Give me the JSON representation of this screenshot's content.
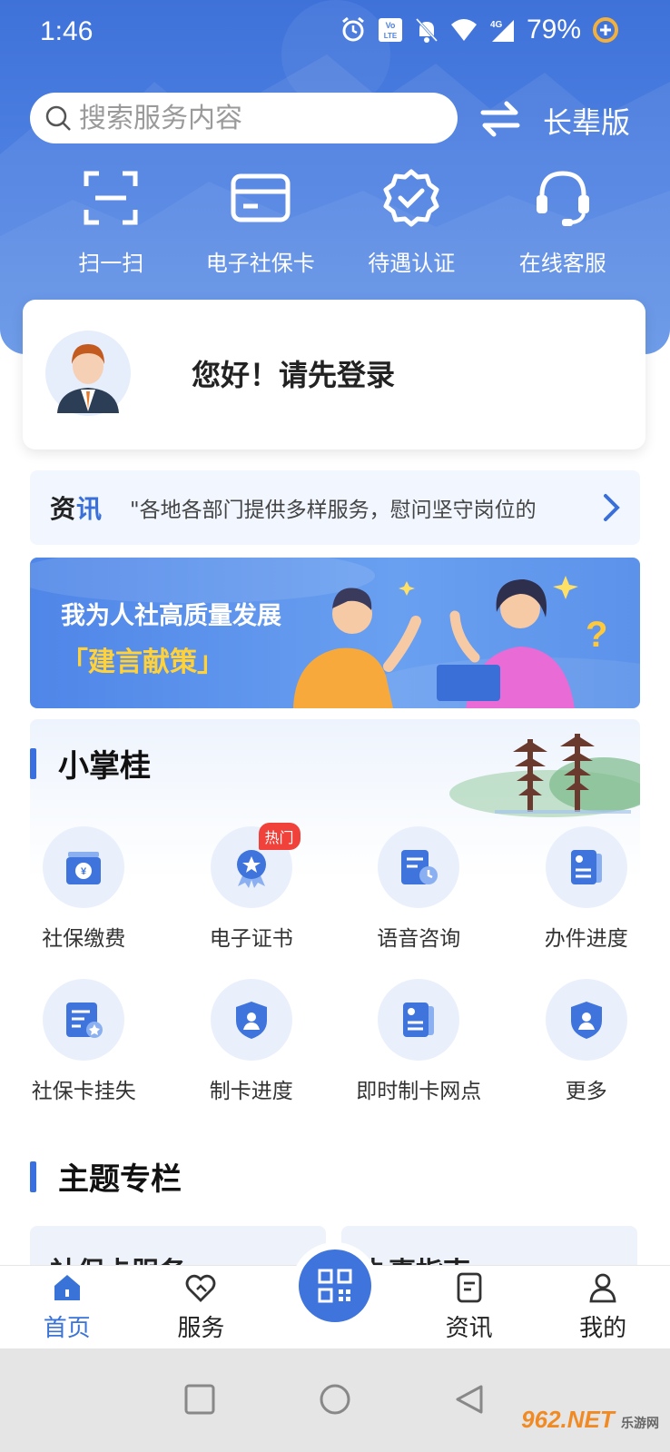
{
  "status_bar": {
    "time": "1:46",
    "battery": "79%",
    "icons": [
      "alarm-icon",
      "volte-icon",
      "mute-icon",
      "wifi-icon",
      "signal-4g-icon",
      "battery-saver-icon"
    ]
  },
  "header": {
    "search_placeholder": "搜索服务内容",
    "elder_mode": "长辈版",
    "quick_actions": [
      {
        "label": "扫一扫",
        "icon": "scan-icon"
      },
      {
        "label": "电子社保卡",
        "icon": "card-icon"
      },
      {
        "label": "待遇认证",
        "icon": "verified-badge-icon"
      },
      {
        "label": "在线客服",
        "icon": "headset-icon"
      }
    ]
  },
  "login_card": {
    "greeting": "您好！请先登录"
  },
  "news": {
    "tag_prefix": "资",
    "tag_suffix": "讯",
    "text": "\"各地各部门提供多样服务，慰问坚守岗位的"
  },
  "banner": {
    "line1": "我为人社高质量发展",
    "line2": "「建言献策」"
  },
  "section_xiaozhanggui": {
    "title": "小掌桂",
    "items": [
      {
        "label": "社保缴费",
        "icon": "payment-icon"
      },
      {
        "label": "电子证书",
        "icon": "certificate-icon",
        "badge": "热门"
      },
      {
        "label": "语音咨询",
        "icon": "voice-consult-icon"
      },
      {
        "label": "办件进度",
        "icon": "progress-doc-icon"
      },
      {
        "label": "社保卡挂失",
        "icon": "card-loss-icon"
      },
      {
        "label": "制卡进度",
        "icon": "card-progress-icon"
      },
      {
        "label": "即时制卡网点",
        "icon": "card-outlet-icon"
      },
      {
        "label": "更多",
        "icon": "more-icon"
      }
    ]
  },
  "section_topics": {
    "title": "主题专栏",
    "cards": [
      "社保卡服务",
      "办事指南"
    ]
  },
  "tab_bar": {
    "tabs": [
      {
        "label": "首页",
        "icon": "home-icon",
        "active": true
      },
      {
        "label": "服务",
        "icon": "service-icon",
        "active": false
      },
      {
        "label": "资讯",
        "icon": "news-icon",
        "active": false
      },
      {
        "label": "我的",
        "icon": "profile-icon",
        "active": false
      }
    ],
    "center_icon": "qr-code-icon"
  },
  "watermark": {
    "brand": "962.NET",
    "sub": "乐游网"
  },
  "colors": {
    "primary": "#3f74dc",
    "hero": "#4f82e2",
    "hot_badge": "#f0413a",
    "banner_highlight": "#ffd23a"
  }
}
